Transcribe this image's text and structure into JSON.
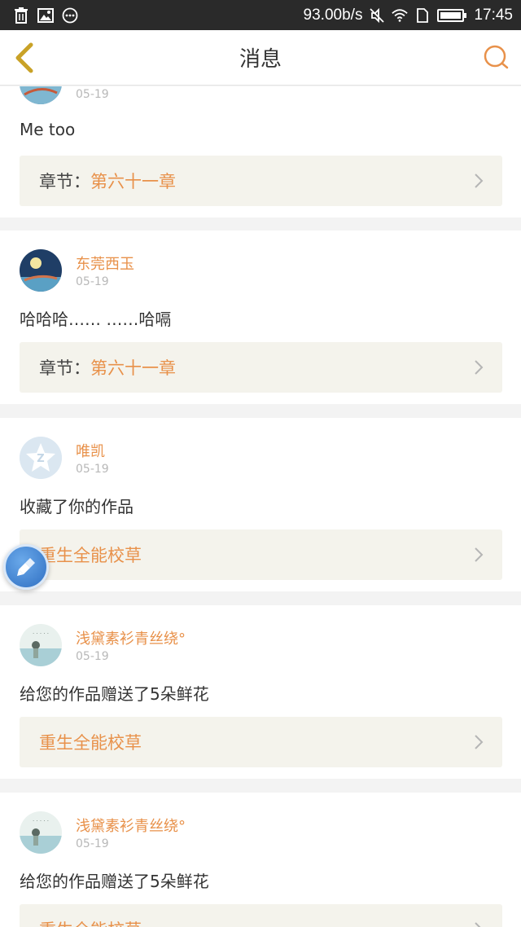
{
  "status_bar": {
    "speed": "93.00b/s",
    "time": "17:45",
    "icons": [
      "trash-icon",
      "image-icon",
      "more-dots-icon",
      "mute-icon",
      "wifi-icon",
      "sim-icon",
      "battery-icon"
    ]
  },
  "header": {
    "title": "消息",
    "back_icon": "chevron-left-icon",
    "search_icon": "search-icon"
  },
  "colors": {
    "accent": "#e8914a",
    "back_arrow": "#c9a227",
    "ref_bg": "#f4f3ec"
  },
  "messages": [
    {
      "username": "",
      "date": "05-19",
      "text": "Me too",
      "ref_label": "章节：",
      "ref_value": "第六十一章"
    },
    {
      "username": "东莞西玉",
      "date": "05-19",
      "text": "哈哈哈…… ……哈嗝",
      "ref_label": "章节：",
      "ref_value": "第六十一章"
    },
    {
      "username": "唯凯",
      "date": "05-19",
      "text": "收藏了你的作品",
      "ref_label": "",
      "ref_value": "重生全能校草"
    },
    {
      "username": "浅黛素衫青丝绕°",
      "date": "05-19",
      "text": "给您的作品赠送了5朵鲜花",
      "ref_label": "",
      "ref_value": "重生全能校草"
    },
    {
      "username": "浅黛素衫青丝绕°",
      "date": "05-19",
      "text": "给您的作品赠送了5朵鲜花",
      "ref_label": "",
      "ref_value": "重生全能校草"
    }
  ]
}
